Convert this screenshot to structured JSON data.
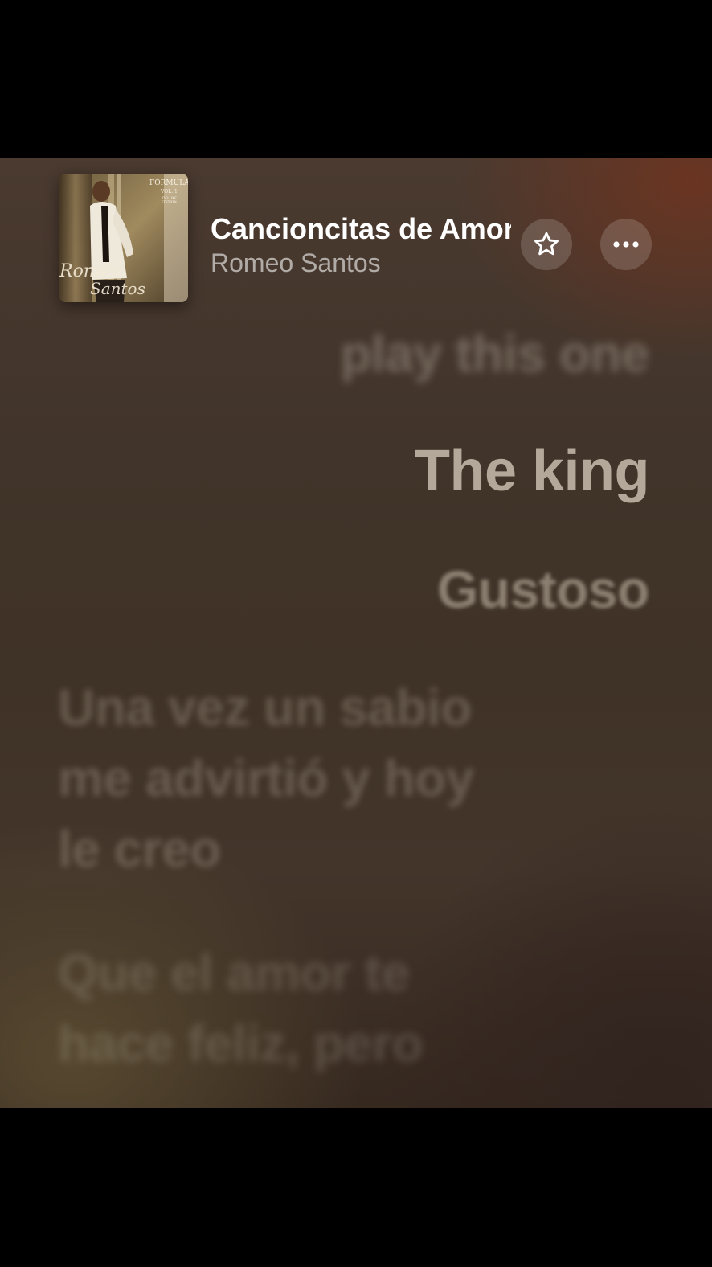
{
  "now_playing": {
    "title": "Cancioncitas de Amor",
    "artist": "Romeo Santos",
    "album_art": {
      "artist_script": "Romeo Santos",
      "cover_text": [
        "FÓRMULA",
        "VOL. 1",
        "DELUXE",
        "EDITION"
      ]
    }
  },
  "controls": {
    "favorite_icon": "star-outline-icon",
    "more_icon": "ellipsis-icon"
  },
  "lyrics": {
    "previous": "play this one",
    "current": "The king",
    "next": "Gustoso",
    "paragraph_1": [
      "Una vez un sabio",
      "me advirtió y hoy",
      "le creo"
    ],
    "paragraph_2": [
      "Que el amor te",
      "hace feliz, pero"
    ]
  },
  "colors": {
    "background_top": "#4a3a30",
    "background_bottom": "#35281f",
    "title_text": "#ffffff",
    "artist_text": "#a29a92"
  }
}
